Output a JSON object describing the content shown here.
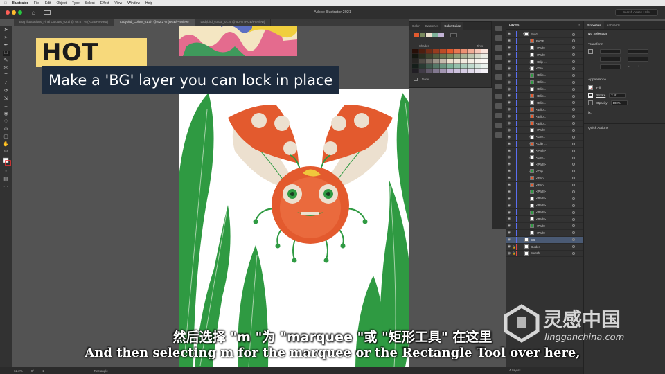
{
  "menubar": {
    "items": [
      "Illustrator",
      "File",
      "Edit",
      "Object",
      "Type",
      "Select",
      "Effect",
      "View",
      "Window",
      "Help"
    ]
  },
  "app": {
    "title": "Adobe Illustrator 2021",
    "search_placeholder": "Search Adobe Help"
  },
  "tabs": [
    {
      "label": "Bug Illustrations_Final Colours_02.ai @ 66.67 % (RGB/Preview)",
      "active": false
    },
    {
      "label": "Ladybird_Colour_01.ai* @ 62.2 % (RGB/Preview)",
      "active": true
    },
    {
      "label": "Ladybird_colour_01.ai @ 50 % (RGB/Preview)",
      "active": false
    }
  ],
  "overlay": {
    "heading": "HOT TIP",
    "tip": "Make a 'BG' layer you can lock in place"
  },
  "color_guide": {
    "tabs": [
      "Color",
      "Swatches",
      "Color Guide"
    ],
    "shades_label": "Shades",
    "tints_label": "Tints",
    "none_label": "None"
  },
  "layers": {
    "title": "Layers",
    "footer": "4 Layers",
    "rows": [
      {
        "name": "Build",
        "indent": 0,
        "expanded": true,
        "thumb": "#ffffff"
      },
      {
        "name": "PAGE...",
        "indent": 1,
        "thumb": "#e35a2e"
      },
      {
        "name": "<Path>",
        "indent": 1,
        "thumb": "#ffffff"
      },
      {
        "name": "<Path>",
        "indent": 1,
        "thumb": "#ffffff"
      },
      {
        "name": "<Clip ...",
        "indent": 1,
        "thumb": "#ffffff"
      },
      {
        "name": "<Gro...",
        "indent": 1,
        "thumb": "#ffffff"
      },
      {
        "name": "<Ellip...",
        "indent": 1,
        "thumb": "#2f9a42"
      },
      {
        "name": "<Ellip...",
        "indent": 1,
        "thumb": "#2f9a42"
      },
      {
        "name": "<Ellip...",
        "indent": 1,
        "thumb": "#ffffff"
      },
      {
        "name": "<Ellip...",
        "indent": 1,
        "thumb": "#e35a2e"
      },
      {
        "name": "<Ellip...",
        "indent": 1,
        "thumb": "#ffffff"
      },
      {
        "name": "<Ellip...",
        "indent": 1,
        "thumb": "#e35a2e"
      },
      {
        "name": "<Ellip...",
        "indent": 1,
        "thumb": "#e35a2e"
      },
      {
        "name": "<Ellip...",
        "indent": 1,
        "thumb": "#e35a2e"
      },
      {
        "name": "<Path>",
        "indent": 1,
        "thumb": "#ffffff"
      },
      {
        "name": "<Gro...",
        "indent": 1,
        "thumb": "#ffffff"
      },
      {
        "name": "<Clip ...",
        "indent": 1,
        "thumb": "#e35a2e"
      },
      {
        "name": "<Path>",
        "indent": 1,
        "thumb": "#ffffff"
      },
      {
        "name": "<Gro...",
        "indent": 1,
        "thumb": "#ffffff"
      },
      {
        "name": "<Path>",
        "indent": 1,
        "thumb": "#ffffff"
      },
      {
        "name": "<Clip ...",
        "indent": 1,
        "thumb": "#2f9a42"
      },
      {
        "name": "<Ellip...",
        "indent": 1,
        "thumb": "#e35a2e"
      },
      {
        "name": "<Ellip...",
        "indent": 1,
        "thumb": "#e35a2e"
      },
      {
        "name": "<Path>",
        "indent": 1,
        "thumb": "#2f9a42"
      },
      {
        "name": "<Path>",
        "indent": 1,
        "thumb": "#ffffff"
      },
      {
        "name": "<Path>",
        "indent": 1,
        "thumb": "#ffffff"
      },
      {
        "name": "<Path>",
        "indent": 1,
        "thumb": "#2f9a42"
      },
      {
        "name": "<Path>",
        "indent": 1,
        "thumb": "#ffffff"
      },
      {
        "name": "<Path>",
        "indent": 1,
        "thumb": "#2f9a42"
      },
      {
        "name": "<Path>",
        "indent": 1,
        "thumb": "#ffffff"
      },
      {
        "name": "BG",
        "indent": 0,
        "selected": true,
        "thumb": "#ffffff"
      },
      {
        "name": "Guides",
        "indent": 0,
        "locked": true,
        "thumb": "#ffffff"
      },
      {
        "name": "Sketch",
        "indent": 0,
        "locked": true,
        "thumb": "#ffffff"
      }
    ]
  },
  "properties": {
    "tabs": [
      "Properties",
      "Artboards"
    ],
    "selection": "No Selection",
    "transform": "Transform",
    "appearance": "Appearance",
    "fill_label": "Fill",
    "stroke_label": "Stroke",
    "stroke_value": "2 pt",
    "opacity_label": "Opacity",
    "opacity_value": "100%",
    "fx_label": "fx.",
    "quick_actions": "Quick Actions"
  },
  "statusbar": {
    "zoom": "62.2%",
    "angle": "0°",
    "artboard_index": "1",
    "tool": "Rectangle"
  },
  "subtitles": {
    "zh": "然后选择 \"m \"为 \"marquee \"或 \"矩形工具\" 在这里",
    "en": "And then selecting m for the marquee or the Rectangle Tool over here,"
  },
  "watermark": {
    "cn": "灵感中国",
    "url": "lingganchina.com"
  },
  "colors": {
    "leaf_green": "#2f9a42",
    "ladybird_red": "#e35a2e",
    "wing_cream": "#ece0cf",
    "hot_tip_yellow": "#f7d97b",
    "tip_navy": "#1d2b3d",
    "selection_blue": "#4a5a74"
  }
}
